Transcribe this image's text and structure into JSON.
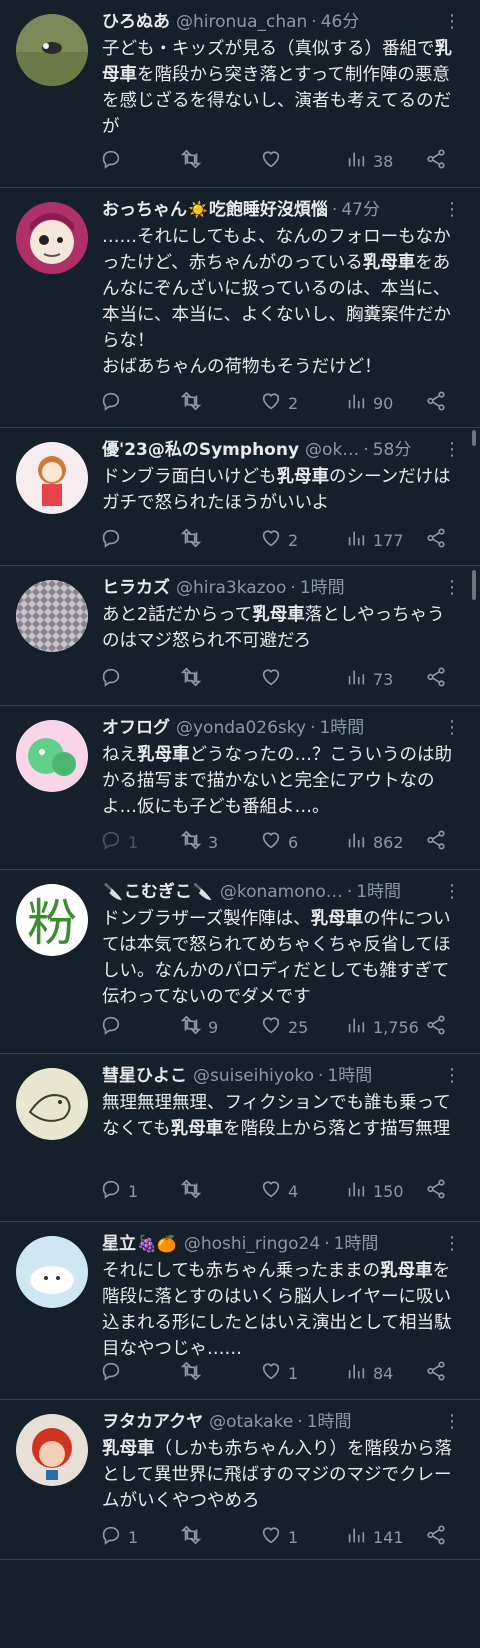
{
  "tweets": [
    {
      "name": "ひろぬあ",
      "handle": "@hironua_chan",
      "time": "46分",
      "body": [
        {
          "t": "子ども・キッズが見る（真似する）番組で"
        },
        {
          "t": "乳母車",
          "b": true
        },
        {
          "t": "を階段から突き落とすって制作陣の悪意を感じざるを得ないし、演者も考えてるのだが"
        }
      ],
      "replies": "",
      "retweets": "",
      "likes": "",
      "views": "38"
    },
    {
      "name": "おっちゃん",
      "name_emoji": "☀️",
      "name_suffix": "吃飽睡好沒煩惱",
      "handle": "",
      "time": "47分",
      "body": [
        {
          "t": "……それにしてもよ、なんのフォローもなかったけど、赤ちゃんがのっている"
        },
        {
          "t": "乳母車",
          "b": true
        },
        {
          "t": "をあんなにぞんざいに扱っているのは、本当に、本当に、本当に、よくないし、胸糞案件だからな！\nおばあちゃんの荷物もそうだけど！"
        }
      ],
      "replies": "",
      "retweets": "",
      "likes": "2",
      "views": "90"
    },
    {
      "name": "優'23@私のSymphony",
      "handle": "@ok…",
      "time": "58分",
      "body": [
        {
          "t": "ドンブラ面白いけども"
        },
        {
          "t": "乳母車",
          "b": true
        },
        {
          "t": "のシーンだけはガチで怒られたほうがいいよ"
        }
      ],
      "replies": "",
      "retweets": "",
      "likes": "2",
      "views": "177"
    },
    {
      "name": "ヒラカズ",
      "handle": "@hira3kazoo",
      "time": "1時間",
      "body": [
        {
          "t": "あと2話だからって"
        },
        {
          "t": "乳母車",
          "b": true
        },
        {
          "t": "落としやっちゃうのはマジ怒られ不可避だろ"
        }
      ],
      "replies": "",
      "retweets": "",
      "likes": "",
      "views": "73"
    },
    {
      "name": "オフログ",
      "handle": "@yonda026sky",
      "time": "1時間",
      "body": [
        {
          "t": "ねえ"
        },
        {
          "t": "乳母車",
          "b": true
        },
        {
          "t": "どうなったの…？こういうのは助かる描写まで描かないと完全にアウトなのよ…仮にも子ども番組よ…。"
        }
      ],
      "replies": "1",
      "retweets": "3",
      "likes": "6",
      "views": "862"
    },
    {
      "name": "こむぎこ",
      "name_emoji": "🔪",
      "handle": "@konamono…",
      "time": "1時間",
      "body": [
        {
          "t": "ドンブラザーズ製作陣は、"
        },
        {
          "t": "乳母車",
          "b": true
        },
        {
          "t": "の件については本気で怒られてめちゃくちゃ反省してほしい。なんかのパロディだとしても雑すぎて伝わってないのでダメです"
        }
      ],
      "replies": "",
      "retweets": "9",
      "likes": "25",
      "views": "1,756"
    },
    {
      "name": "彗星ひよこ",
      "handle": "@suiseihiyoko",
      "time": "1時間",
      "body": [
        {
          "t": "無理無理無理、フィクションでも誰も乗ってなくても"
        },
        {
          "t": "乳母車",
          "b": true
        },
        {
          "t": "を階段上から落とす描写無理"
        }
      ],
      "replies": "1",
      "retweets": "",
      "likes": "4",
      "views": "150"
    },
    {
      "name": "星立",
      "name_emoji": "🍇🍊",
      "handle": "@hoshi_ringo24",
      "time": "1時間",
      "body": [
        {
          "t": "それにしても赤ちゃん乗ったままの"
        },
        {
          "t": "乳母車",
          "b": true
        },
        {
          "t": "を階段に落とすのはいくら脳人レイヤーに吸い込まれる形にしたとはいえ演出として相当駄目なやつじゃ……"
        }
      ],
      "replies": "",
      "retweets": "",
      "likes": "1",
      "views": "84"
    },
    {
      "name": "ヲタカアクヤ",
      "handle": "@otakake",
      "time": "1時間",
      "body": [
        {
          "t": "乳母車",
          "b": true
        },
        {
          "t": "（しかも赤ちゃん入り）を階段から落として異世界に飛ばすのマジのマジでクレームがいくやつやめろ"
        }
      ],
      "replies": "1",
      "retweets": "",
      "likes": "1",
      "views": "141"
    }
  ],
  "icons": {
    "reply": "reply-icon",
    "retweet": "retweet-icon",
    "like": "heart-icon",
    "views": "views-icon",
    "share": "share-icon",
    "more": "more-options-icon"
  },
  "colors": {
    "background": "#15202b",
    "text": "#e7e9ea",
    "secondary": "#8b98a5",
    "divider": "#38444d"
  }
}
